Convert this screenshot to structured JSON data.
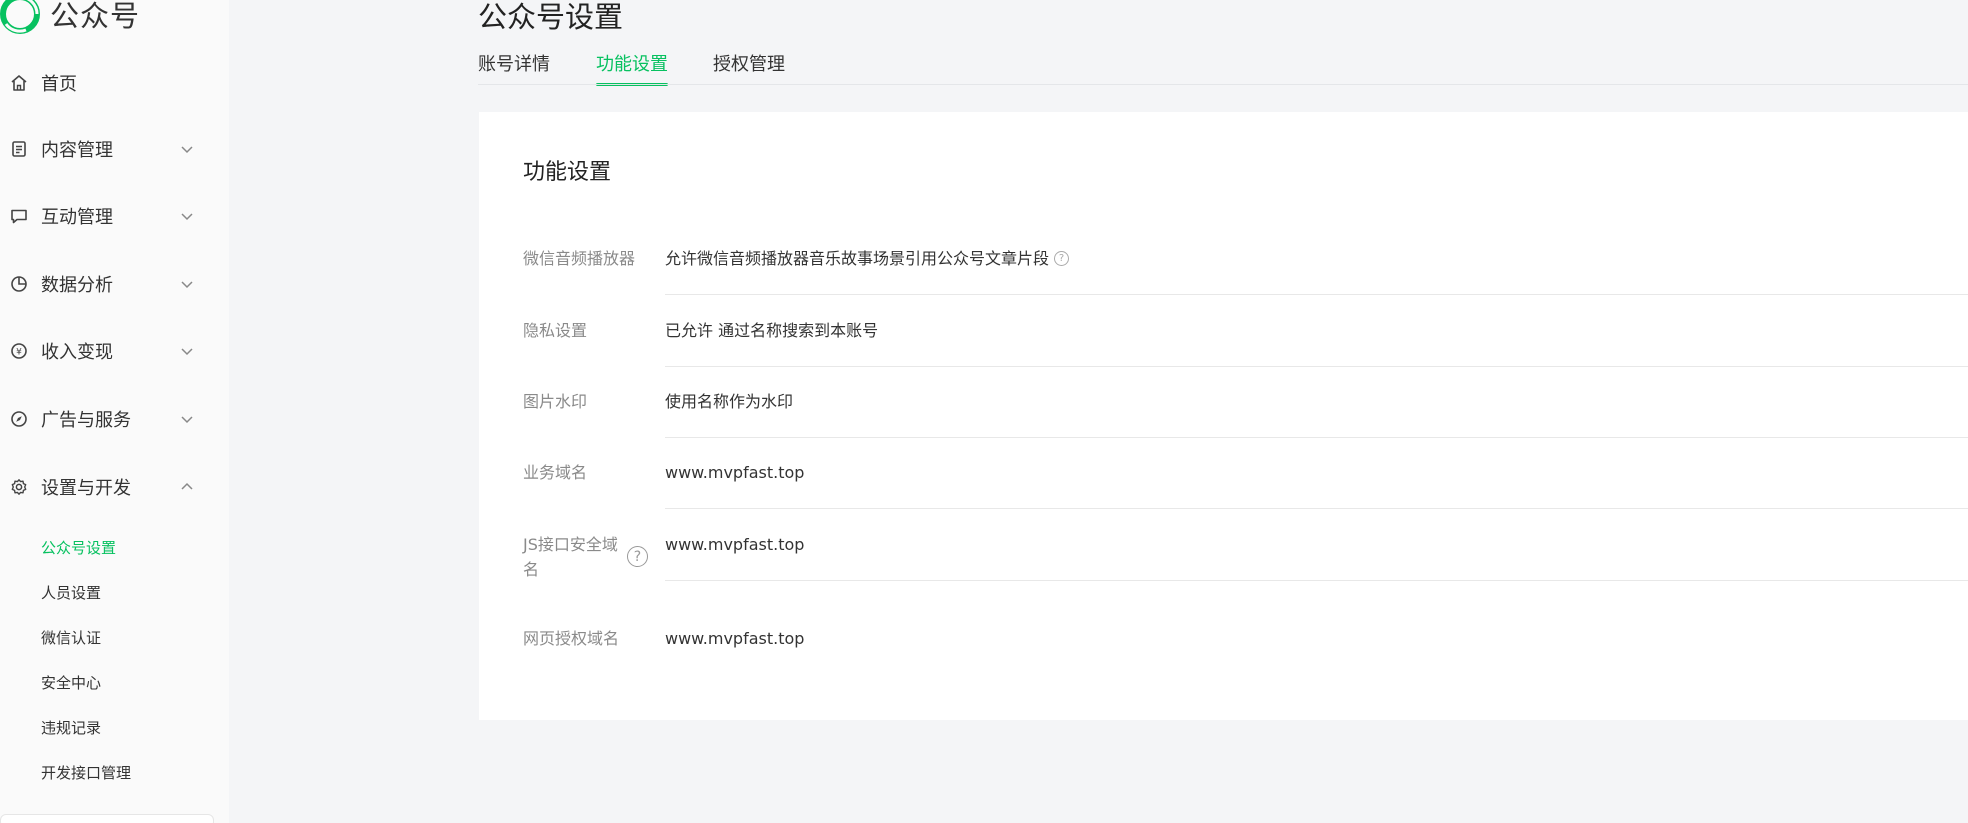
{
  "brand": {
    "name": "公众号"
  },
  "sidebar": {
    "items": [
      {
        "label": "首页",
        "icon": "home-icon"
      },
      {
        "label": "内容管理",
        "icon": "document-icon",
        "expanded": false
      },
      {
        "label": "互动管理",
        "icon": "chat-icon",
        "expanded": false
      },
      {
        "label": "数据分析",
        "icon": "pie-chart-icon",
        "expanded": false
      },
      {
        "label": "收入变现",
        "icon": "yen-icon",
        "expanded": false
      },
      {
        "label": "广告与服务",
        "icon": "compass-icon",
        "expanded": false
      },
      {
        "label": "设置与开发",
        "icon": "gear-icon",
        "expanded": true
      }
    ],
    "subitems": [
      {
        "label": "公众号设置",
        "active": true
      },
      {
        "label": "人员设置"
      },
      {
        "label": "微信认证"
      },
      {
        "label": "安全中心"
      },
      {
        "label": "违规记录"
      },
      {
        "label": "开发接口管理"
      }
    ]
  },
  "header": {
    "title": "公众号设置"
  },
  "tabs": [
    {
      "label": "账号详情"
    },
    {
      "label": "功能设置",
      "active": true
    },
    {
      "label": "授权管理"
    }
  ],
  "card": {
    "title": "功能设置",
    "rows": [
      {
        "label": "微信音频播放器",
        "value": "允许微信音频播放器音乐故事场景引用公众号文章片段",
        "help": true
      },
      {
        "label": "隐私设置",
        "value": "已允许 通过名称搜索到本账号"
      },
      {
        "label": "图片水印",
        "value": "使用名称作为水印"
      },
      {
        "label": "业务域名",
        "value": "www.mvpfast.top"
      },
      {
        "label_line1": "JS接口安全域",
        "label_line2": "名",
        "value": "www.mvpfast.top",
        "help": true
      },
      {
        "label": "网页授权域名",
        "value": "www.mvpfast.top"
      }
    ]
  },
  "colors": {
    "accent": "#07c160",
    "background": "#f4f5f7",
    "card": "#ffffff"
  }
}
